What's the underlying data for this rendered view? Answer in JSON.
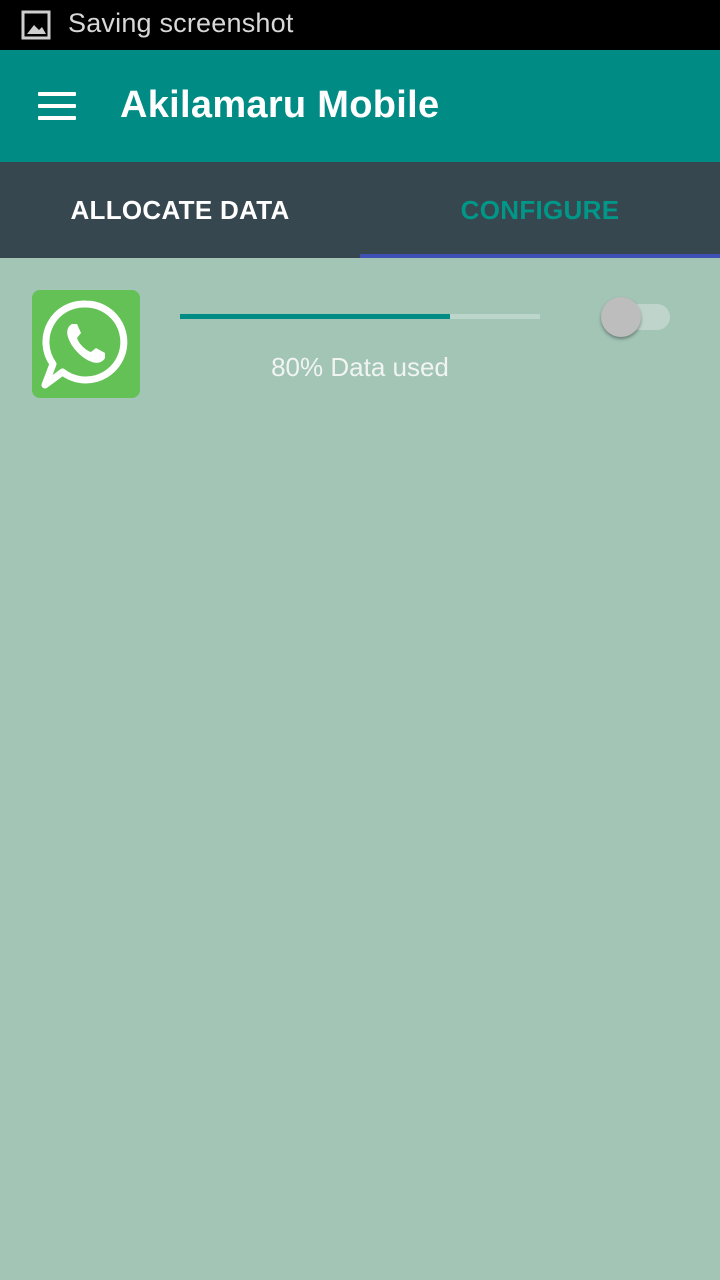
{
  "status_bar": {
    "text": "Saving screenshot",
    "icon": "image-icon"
  },
  "app_bar": {
    "menu_icon": "hamburger-menu-icon",
    "title": "Akilamaru Mobile",
    "color": "#008b85"
  },
  "tabs": [
    {
      "label": "ALLOCATE DATA",
      "selected": false
    },
    {
      "label": "CONFIGURE",
      "selected": true
    }
  ],
  "app_list": [
    {
      "app_icon": "whatsapp-icon",
      "usage_fraction": 0.75,
      "usage_text": "80% Data used",
      "toggle_on": false
    }
  ],
  "colors": {
    "primary": "#008b85",
    "tab_bar": "#37474f",
    "tab_indicator": "#3f51b5",
    "background": "#a2c5b6",
    "whatsapp_green": "#64c156"
  }
}
